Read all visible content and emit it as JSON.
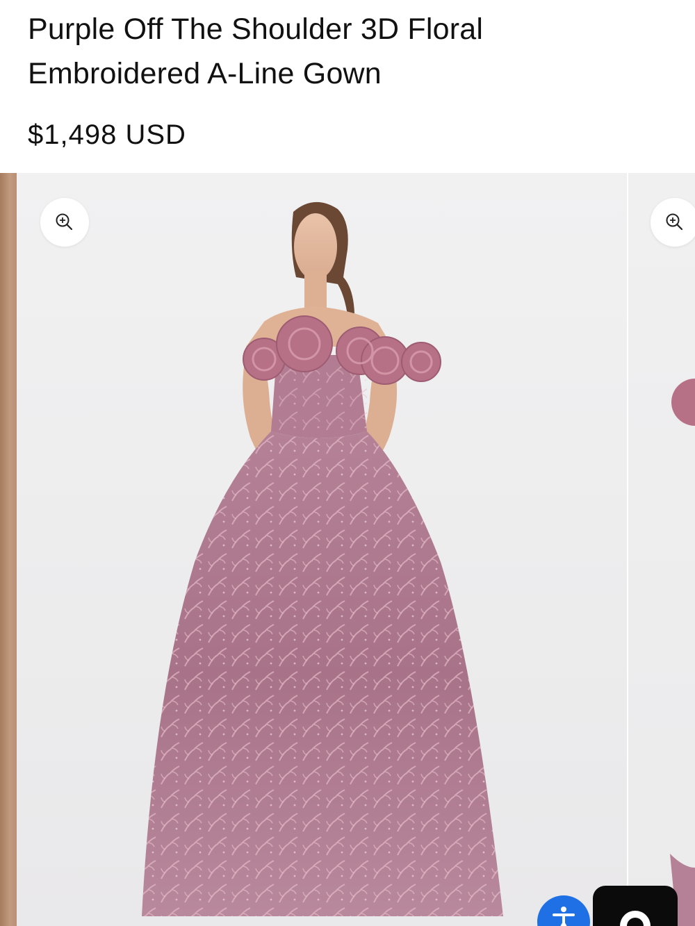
{
  "product": {
    "title": "Purple Off The Shoulder 3D Floral Embroidered A-Line Gown",
    "price": "$1,498 USD"
  },
  "gallery": {
    "zoom_icon": "zoom-in-icon",
    "main_image": "model-in-mauve-off-shoulder-floral-gown",
    "dress_color": "#b07a8f",
    "background_color": "#eeeeef"
  },
  "widgets": {
    "accessibility_icon": "accessibility-icon",
    "accessibility_color": "#1f6fe5",
    "chat_icon": "chat-icon",
    "chat_color": "#0b0b0b"
  }
}
